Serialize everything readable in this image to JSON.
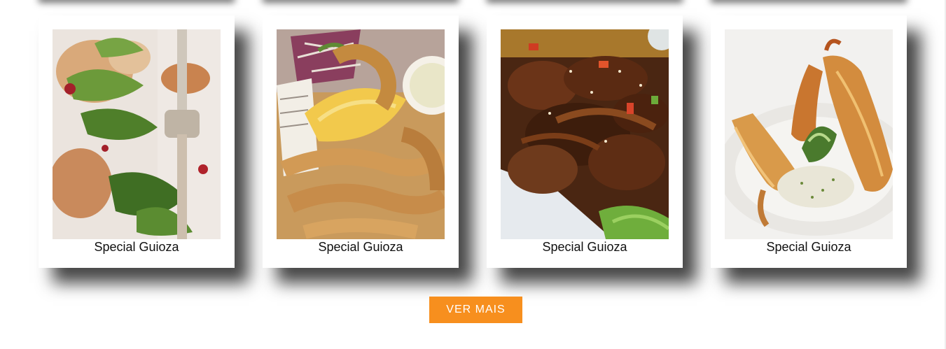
{
  "cards": [
    {
      "caption": "Special Guioza",
      "image": "salad-with-fork-photo"
    },
    {
      "caption": "Special Guioza",
      "image": "fried-fish-with-lemon-photo"
    },
    {
      "caption": "Special Guioza",
      "image": "glazed-ribs-photo"
    },
    {
      "caption": "Special Guioza",
      "image": "kataifi-shrimp-photo"
    }
  ],
  "more_button": {
    "label": "VER MAIS"
  },
  "colors": {
    "accent": "#f78f1e",
    "card_bg": "#ffffff",
    "caption_text": "#111111"
  }
}
